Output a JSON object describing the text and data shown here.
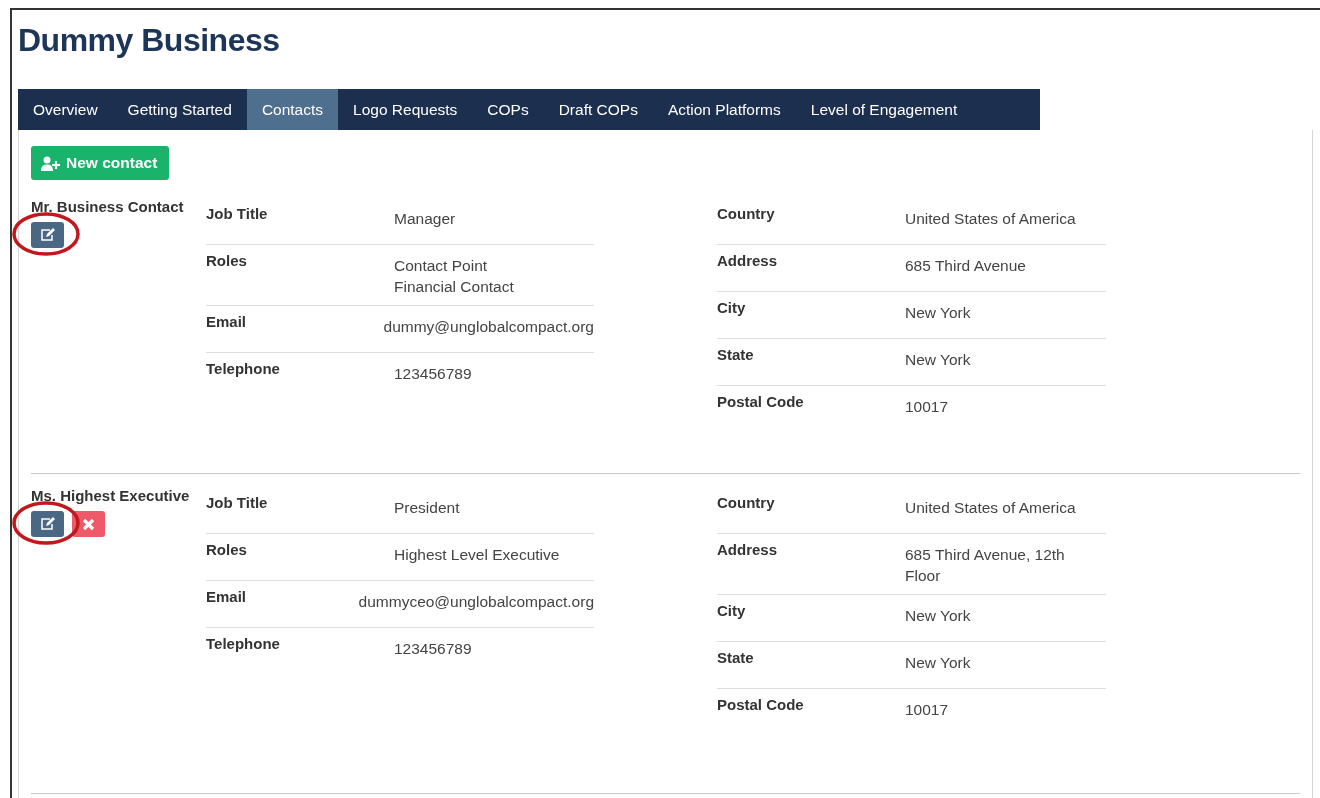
{
  "page": {
    "title": "Dummy Business"
  },
  "tabs": [
    {
      "label": "Overview",
      "selected": false
    },
    {
      "label": "Getting Started",
      "selected": false
    },
    {
      "label": "Contacts",
      "selected": true
    },
    {
      "label": "Logo Requests",
      "selected": false
    },
    {
      "label": "COPs",
      "selected": false
    },
    {
      "label": "Draft COPs",
      "selected": false
    },
    {
      "label": "Action Platforms",
      "selected": false
    },
    {
      "label": "Level of Engagement",
      "selected": false
    }
  ],
  "new_contact_button": {
    "label": "New contact"
  },
  "contacts": [
    {
      "name": "Mr. Business Contact",
      "deletable": false,
      "edit_circled": true,
      "personal": [
        {
          "label": "Job Title",
          "values": [
            "Manager"
          ]
        },
        {
          "label": "Roles",
          "values": [
            "Contact Point",
            "Financial Contact"
          ]
        },
        {
          "label": "Email",
          "values": [
            "dummy@unglobalcompact.org"
          ]
        },
        {
          "label": "Telephone",
          "values": [
            "123456789"
          ]
        }
      ],
      "location": [
        {
          "label": "Country",
          "values": [
            "United States of America"
          ]
        },
        {
          "label": "Address",
          "values": [
            "685 Third Avenue"
          ]
        },
        {
          "label": "City",
          "values": [
            "New York"
          ]
        },
        {
          "label": "State",
          "values": [
            "New York"
          ]
        },
        {
          "label": "Postal Code",
          "values": [
            "10017"
          ]
        }
      ]
    },
    {
      "name": "Ms. Highest Executive",
      "deletable": true,
      "edit_circled": true,
      "personal": [
        {
          "label": "Job Title",
          "values": [
            "President"
          ]
        },
        {
          "label": "Roles",
          "values": [
            "Highest Level Executive"
          ]
        },
        {
          "label": "Email",
          "values": [
            "dummyceo@unglobalcompact.org"
          ]
        },
        {
          "label": "Telephone",
          "values": [
            "123456789"
          ]
        }
      ],
      "location": [
        {
          "label": "Country",
          "values": [
            "United States of America"
          ]
        },
        {
          "label": "Address",
          "values": [
            "685 Third Avenue, 12th Floor"
          ]
        },
        {
          "label": "City",
          "values": [
            "New York"
          ]
        },
        {
          "label": "State",
          "values": [
            "New York"
          ]
        },
        {
          "label": "Postal Code",
          "values": [
            "10017"
          ]
        }
      ]
    }
  ]
}
